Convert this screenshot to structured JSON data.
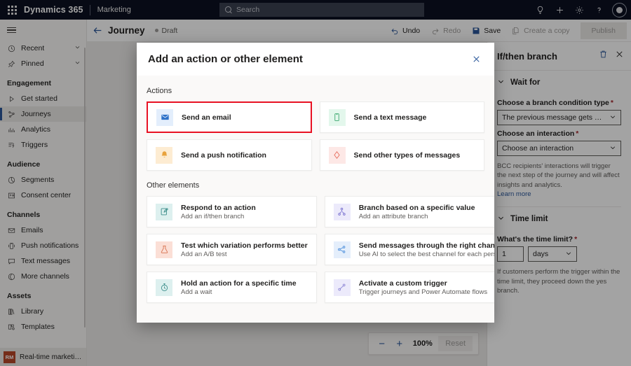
{
  "topbar": {
    "waffle_icon": "app-launcher-waffle-icon",
    "brand": "Dynamics 365",
    "app_name": "Marketing",
    "search_placeholder": "Search",
    "icons": [
      {
        "name": "lightbulb-icon",
        "glyph": "☉"
      },
      {
        "name": "plus-icon",
        "glyph": "+"
      },
      {
        "name": "gear-icon",
        "glyph": "⚙"
      },
      {
        "name": "help-icon",
        "glyph": "?"
      }
    ],
    "avatar_name": "user-avatar"
  },
  "sidebar": {
    "hamburger_label": "Site map",
    "top_items": [
      {
        "label": "Recent",
        "icon": "clock-icon",
        "expandable": true
      },
      {
        "label": "Pinned",
        "icon": "pin-icon",
        "expandable": true
      }
    ],
    "groups": [
      {
        "title": "Engagement",
        "items": [
          {
            "label": "Get started",
            "icon": "play-icon",
            "selected": false
          },
          {
            "label": "Journeys",
            "icon": "journeys-icon",
            "selected": true
          },
          {
            "label": "Analytics",
            "icon": "analytics-icon",
            "selected": false
          },
          {
            "label": "Triggers",
            "icon": "triggers-icon",
            "selected": false
          }
        ]
      },
      {
        "title": "Audience",
        "items": [
          {
            "label": "Segments",
            "icon": "segments-icon",
            "selected": false
          },
          {
            "label": "Consent center",
            "icon": "consent-icon",
            "selected": false
          }
        ]
      },
      {
        "title": "Channels",
        "items": [
          {
            "label": "Emails",
            "icon": "email-icon",
            "selected": false
          },
          {
            "label": "Push notifications",
            "icon": "push-icon",
            "selected": false
          },
          {
            "label": "Text messages",
            "icon": "chat-icon",
            "selected": false
          },
          {
            "label": "More channels",
            "icon": "more-channels-icon",
            "selected": false
          }
        ]
      },
      {
        "title": "Assets",
        "items": [
          {
            "label": "Library",
            "icon": "library-icon",
            "selected": false
          },
          {
            "label": "Templates",
            "icon": "templates-icon",
            "selected": false
          }
        ]
      }
    ],
    "footer": {
      "badge": "RM",
      "label": "Real-time marketi…",
      "badge_color": "#b7472a"
    }
  },
  "commandbar": {
    "back_icon": "back-arrow-icon",
    "title": "Journey",
    "status": "Draft",
    "buttons": [
      {
        "label": "Undo",
        "icon": "undo-icon",
        "disabled": false
      },
      {
        "label": "Redo",
        "icon": "redo-icon",
        "disabled": true
      },
      {
        "label": "Save",
        "icon": "save-icon",
        "disabled": false
      },
      {
        "label": "Create a copy",
        "icon": "copy-icon",
        "disabled": true
      }
    ],
    "publish_label": "Publish"
  },
  "canvas": {
    "zoom": {
      "minus_label": "−",
      "plus_label": "+",
      "value": "100%",
      "reset_label": "Reset"
    }
  },
  "right_panel": {
    "title": "If/then branch",
    "delete_icon": "trash-icon",
    "close_icon": "close-icon",
    "sections": [
      {
        "title": "Wait for",
        "chevron": "chevron-down-icon"
      },
      {
        "title": "Time limit",
        "chevron": "chevron-down-icon"
      }
    ],
    "branch_condition_label": "Choose a branch condition type",
    "branch_condition_value": "The previous message gets an interacti…",
    "interaction_label": "Choose an interaction",
    "interaction_value": "Choose an interaction",
    "interaction_help": "BCC recipients' interactions will trigger the next step of the journey and will affect insights and analytics.",
    "learn_more": "Learn more",
    "time_limit_label": "What's the time limit?",
    "time_limit_value": "1",
    "time_limit_unit": "days",
    "time_limit_help": "If customers perform the trigger within the time limit, they proceed down the yes branch.",
    "required_marker": "*"
  },
  "modal": {
    "title": "Add an action or other element",
    "close_icon": "close-icon",
    "actions_heading": "Actions",
    "other_heading": "Other elements",
    "actions": [
      {
        "title": "Send an email",
        "subtitle": "",
        "icon": "envelope-icon",
        "icon_bg": "#e3eefc",
        "icon_color": "#2f72c8",
        "highlighted": true
      },
      {
        "title": "Send a text message",
        "subtitle": "",
        "icon": "phone-icon",
        "icon_bg": "#e3f7ec",
        "icon_color": "#3aa76d",
        "highlighted": false
      },
      {
        "title": "Send a push notification",
        "subtitle": "",
        "icon": "bell-icon",
        "icon_bg": "#fdecd2",
        "icon_color": "#e8a33d",
        "highlighted": false
      },
      {
        "title": "Send other types of messages",
        "subtitle": "",
        "icon": "diamond-icon",
        "icon_bg": "#fde8e6",
        "icon_color": "#e76c5c",
        "highlighted": false
      }
    ],
    "other_elements": [
      {
        "title": "Respond to an action",
        "subtitle": "Add an if/then branch",
        "icon": "respond-icon",
        "icon_bg": "#ddf0ef",
        "icon_color": "#3b8d8a",
        "highlighted": false
      },
      {
        "title": "Branch based on a specific value",
        "subtitle": "Add an attribute branch",
        "icon": "branch-icon",
        "icon_bg": "#eceafb",
        "icon_color": "#7a72cf",
        "highlighted": false
      },
      {
        "title": "Test which variation performs better",
        "subtitle": "Add an A/B test",
        "icon": "flask-icon",
        "icon_bg": "#fbdfd6",
        "icon_color": "#d8724f",
        "highlighted": false
      },
      {
        "title": "Send messages through the right channel",
        "subtitle": "Use AI to select the best channel for each person",
        "icon": "channel-ai-icon",
        "icon_bg": "#e4eefb",
        "icon_color": "#4a8ddb",
        "highlighted": false
      },
      {
        "title": "Hold an action for a specific time",
        "subtitle": "Add a wait",
        "icon": "stopwatch-icon",
        "icon_bg": "#ddf0ef",
        "icon_color": "#3b8d8a",
        "highlighted": false
      },
      {
        "title": "Activate a custom trigger",
        "subtitle": "Trigger journeys and Power Automate flows",
        "icon": "custom-trigger-icon",
        "icon_bg": "#eceafb",
        "icon_color": "#8b84d4",
        "highlighted": false
      }
    ],
    "highlight_color": "#e81123"
  }
}
